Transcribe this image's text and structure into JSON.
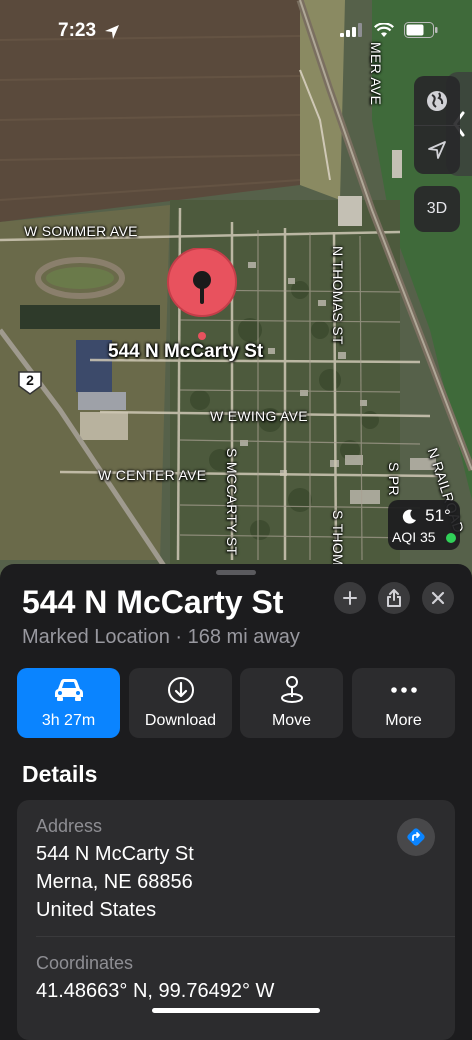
{
  "status_bar": {
    "time": "7:23"
  },
  "map": {
    "streets": {
      "w_sommer": "W SOMMER AVE",
      "w_ewing": "W EWING AVE",
      "w_center": "W CENTER AVE",
      "n_thomas": "N THOMAS ST",
      "s_mccarty": "S MCCARTY ST",
      "s_thomas": "S THOMA",
      "s_pr": "S PR",
      "n_railroad": "N RAILROAD",
      "top_ave": "MER AVE"
    },
    "highway_shield": "2",
    "pin_label": "544 N McCarty St",
    "view_toggle": "3D",
    "weather": {
      "temp": "51°",
      "aqi": "AQI 35"
    },
    "icons": [
      "globe-icon",
      "location-arrow-icon",
      "chevron-left-icon",
      "moon-icon"
    ]
  },
  "place": {
    "title": "544 N McCarty St",
    "subtitle": "Marked Location · 168 mi away"
  },
  "actions": [
    {
      "label": "3h 27m",
      "icon": "car-icon"
    },
    {
      "label": "Download",
      "icon": "download-icon"
    },
    {
      "label": "Move",
      "icon": "pin-move-icon"
    },
    {
      "label": "More",
      "icon": "ellipsis-icon"
    }
  ],
  "details": {
    "heading": "Details",
    "address_label": "Address",
    "address_lines": [
      "544 N McCarty St",
      "Merna, NE  68856",
      "United States"
    ],
    "coordinates_label": "Coordinates",
    "coordinates": "41.48663° N, 99.76492° W"
  },
  "colors": {
    "accent": "#0a84ff",
    "pin": "#e8525e",
    "aqi_good": "#30d158"
  }
}
